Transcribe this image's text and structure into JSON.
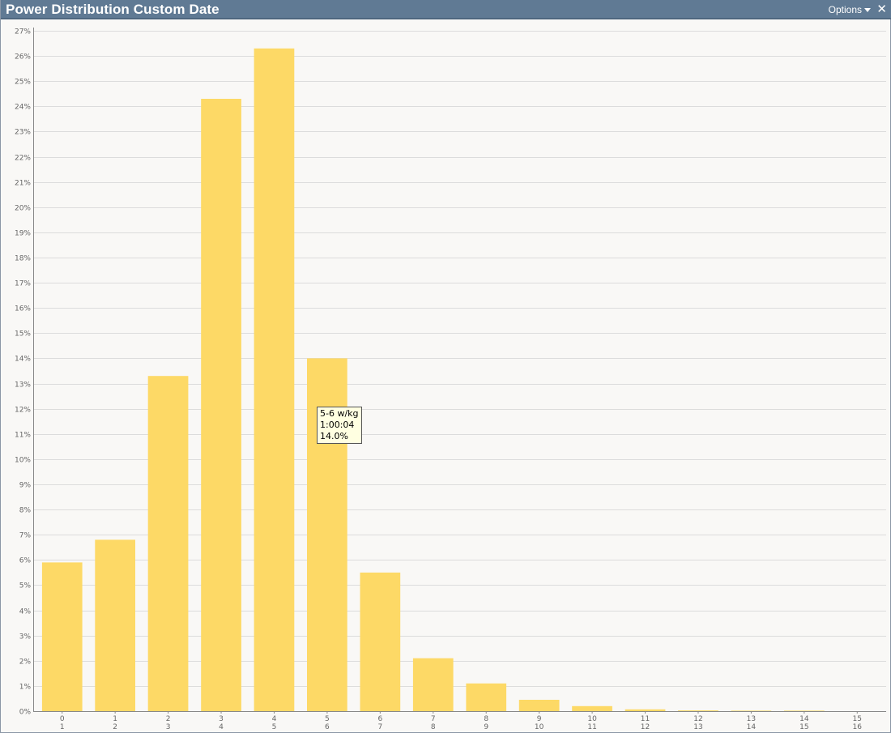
{
  "window": {
    "title": "Power Distribution Custom Date",
    "options_label": "Options",
    "close_glyph": "✕"
  },
  "colors": {
    "bar": "#fdd966",
    "grid": "#dcdcdc",
    "axis": "#888888",
    "tick_text": "#666666",
    "titlebar": "#607a94"
  },
  "tooltip": {
    "line1": "5-6 w/kg",
    "line2": "1:00:04",
    "line3": "14.0%"
  },
  "chart_data": {
    "type": "bar",
    "title": "",
    "xlabel": "",
    "ylabel": "",
    "ylim": [
      0,
      27
    ],
    "y_tick_step": 1,
    "y_tick_suffix": "%",
    "grid": true,
    "categories": [
      [
        "0",
        "1"
      ],
      [
        "1",
        "2"
      ],
      [
        "2",
        "3"
      ],
      [
        "3",
        "4"
      ],
      [
        "4",
        "5"
      ],
      [
        "5",
        "6"
      ],
      [
        "6",
        "7"
      ],
      [
        "7",
        "8"
      ],
      [
        "8",
        "9"
      ],
      [
        "9",
        "10"
      ],
      [
        "10",
        "11"
      ],
      [
        "11",
        "12"
      ],
      [
        "12",
        "13"
      ],
      [
        "13",
        "14"
      ],
      [
        "14",
        "15"
      ],
      [
        "15",
        "16"
      ]
    ],
    "values": [
      5.9,
      6.8,
      13.3,
      24.3,
      26.3,
      14.0,
      5.5,
      2.1,
      1.1,
      0.45,
      0.2,
      0.07,
      0.03,
      0.02,
      0.02,
      0.0
    ]
  }
}
